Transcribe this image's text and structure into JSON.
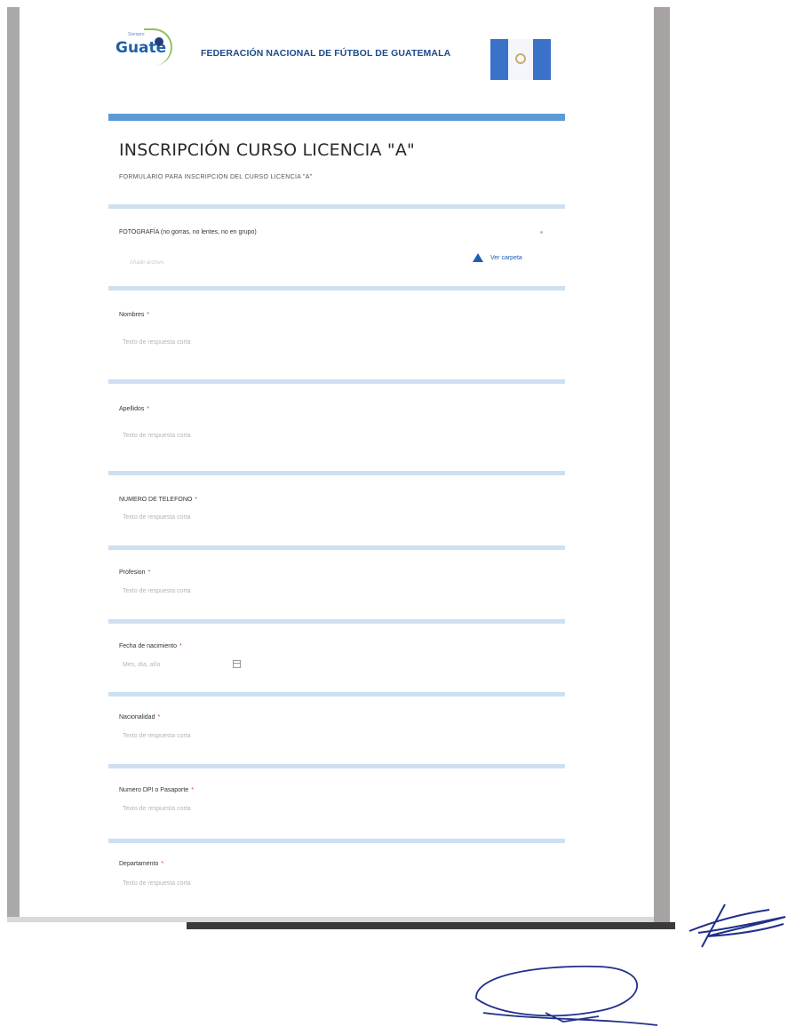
{
  "header": {
    "logo_small": "Siempre",
    "logo_text": "Guate",
    "federation": "FEDERACIÓN NACIONAL DE FÚTBOL DE GUATEMALA"
  },
  "form": {
    "title": "INSCRIPCIÓN CURSO LICENCIA \"A\"",
    "subtitle": "FORMULARIO PARA INSCRIPCION DEL CURSO LICENCIA \"A\""
  },
  "photo": {
    "label": "FOTOGRAFÍA (no gorras, no lentes, no en grupo)",
    "upload_placeholder": "Añadir archivo",
    "drive_label": "Ver carpeta"
  },
  "questions": [
    {
      "label": "Nombres",
      "required": "*",
      "placeholder": "Texto de respuesta corta"
    },
    {
      "label": "Apellidos",
      "required": "*",
      "placeholder": "Texto de respuesta corta"
    },
    {
      "label": "NUMERO DE TELEFONO",
      "required": "*",
      "placeholder": "Texto de respuesta corta"
    },
    {
      "label": "Profesion",
      "required": "*",
      "placeholder": "Texto de respuesta corta"
    },
    {
      "label": "Fecha de nacimiento",
      "required": "*",
      "placeholder": "Mes, día, año"
    },
    {
      "label": "Nacionalidad",
      "required": "*",
      "placeholder": "Texto de respuesta corta"
    },
    {
      "label": "Numero DPI o Pasaporte",
      "required": "*",
      "placeholder": "Texto de respuesta corta"
    },
    {
      "label": "Departamento",
      "required": "*",
      "placeholder": "Texto de respuesta corta"
    }
  ]
}
